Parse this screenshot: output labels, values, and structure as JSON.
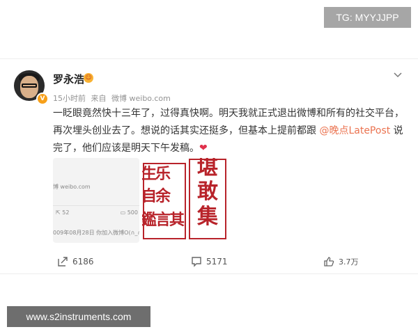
{
  "watermark": {
    "tg": "TG: MYYJJPP",
    "site": "www.s2instruments.com"
  },
  "post": {
    "username": "罗永浩",
    "vip_badge": "☺",
    "verified_badge": "V",
    "time": "15小时前",
    "source_prefix": "来自",
    "source": "微博 weibo.com",
    "text_part1": "一眨眼竟然快十三年了，过得真快啊。明天我就正式退出微博和所有的社交平台，再次埋头创业去了。想说的话其实还挺多，但基本上提前都跟 ",
    "mention": "@晚点LatePost",
    "text_part2": " 说完了，他们应该是明天下午发稿。",
    "heart": "❤",
    "thumb1": {
      "site": "博 weibo.com",
      "forwards": "52",
      "comments": "500",
      "date": "009年08月28日  你加入微博O(∩_∩)"
    },
    "seal_chars": [
      "乐",
      "余",
      "言",
      "自",
      "鑑",
      "堪",
      "敢",
      "集",
      "生",
      "其"
    ]
  },
  "actions": {
    "forward_count": "6186",
    "comment_count": "5171",
    "like_count": "3.7万"
  },
  "colors": {
    "mention": "#eb7350",
    "seal_red": "#b8232a",
    "heart": "#e0314c"
  }
}
